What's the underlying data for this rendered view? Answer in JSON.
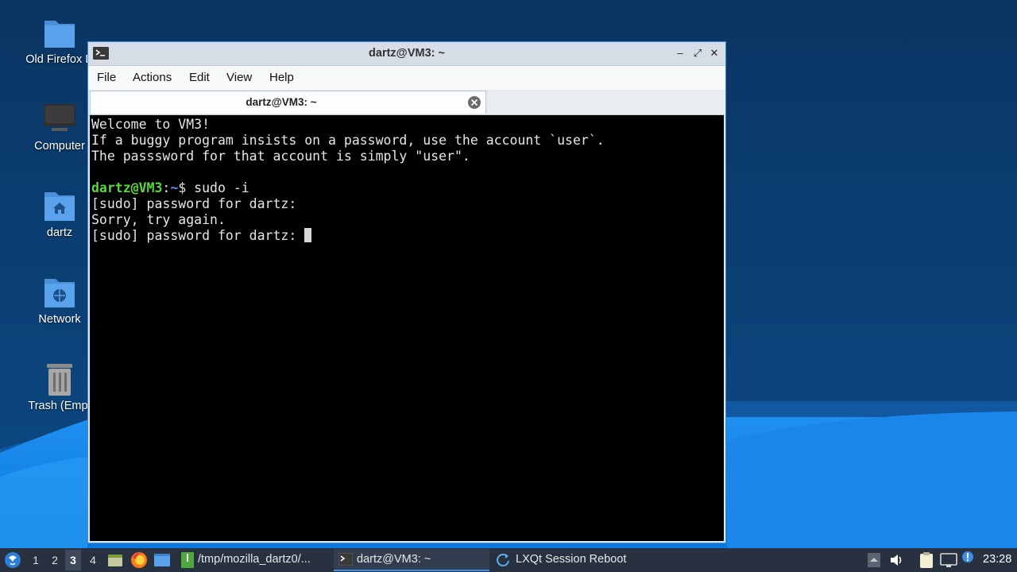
{
  "desktop": {
    "icons": [
      {
        "label": "Old Firefox D",
        "icon": "folder-icon"
      },
      {
        "label": "Computer",
        "icon": "computer-icon"
      },
      {
        "label": "dartz",
        "icon": "home-folder-icon"
      },
      {
        "label": "Network",
        "icon": "network-folder-icon"
      },
      {
        "label": "Trash (Empt",
        "icon": "trash-icon"
      }
    ]
  },
  "window": {
    "title": "dartz@VM3: ~",
    "controls": {
      "minimize": "–",
      "maximize": "⤢",
      "close": "✕"
    },
    "menu": [
      "File",
      "Actions",
      "Edit",
      "View",
      "Help"
    ],
    "tab": {
      "label": "dartz@VM3: ~"
    },
    "terminal": {
      "line1": "Welcome to VM3!",
      "line2": "If a buggy program insists on a password, use the account `user`.",
      "line3": "The passsword for that account is simply \"user\".",
      "prompt_user": "dartz@VM3",
      "prompt_sep": ":",
      "prompt_path": "~",
      "prompt_command": "$ sudo -i",
      "line5": "[sudo] password for dartz:",
      "line6": "Sorry, try again.",
      "line7": "[sudo] password for dartz: "
    }
  },
  "taskbar": {
    "workspaces": [
      "1",
      "2",
      "3",
      "4"
    ],
    "active_workspace": "3",
    "tasks": [
      {
        "label": "/tmp/mozilla_dartz0/...",
        "icon": "archive-icon"
      },
      {
        "label": "dartz@VM3: ~",
        "icon": "terminal-icon"
      },
      {
        "label": "LXQt Session Reboot",
        "icon": "reboot-icon"
      }
    ],
    "clock": "23:28"
  },
  "colors": {
    "accent": "#3a8ee6",
    "taskbar_bg": "#273140",
    "terminal_bg": "#000000",
    "prompt_user": "#5bd63d",
    "prompt_path": "#5a8ee8"
  }
}
